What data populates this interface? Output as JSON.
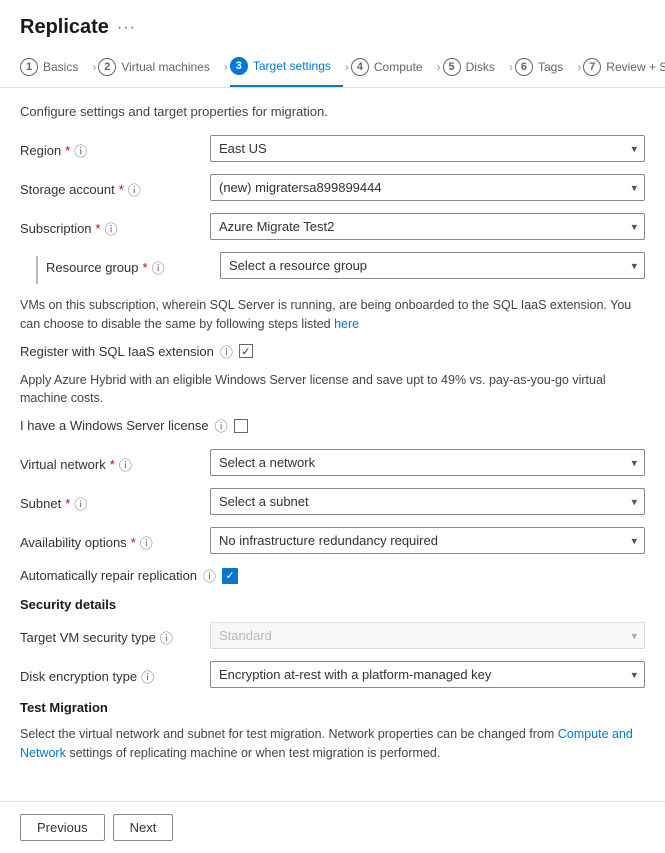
{
  "header": {
    "title": "Replicate",
    "dots": "···"
  },
  "wizard": {
    "steps": [
      {
        "num": "1",
        "label": "Basics",
        "active": false
      },
      {
        "num": "2",
        "label": "Virtual machines",
        "active": false
      },
      {
        "num": "3",
        "label": "Target settings",
        "active": true
      },
      {
        "num": "4",
        "label": "Compute",
        "active": false
      },
      {
        "num": "5",
        "label": "Disks",
        "active": false
      },
      {
        "num": "6",
        "label": "Tags",
        "active": false
      },
      {
        "num": "7",
        "label": "Review + Start replication",
        "active": false
      }
    ]
  },
  "content": {
    "section_desc": "Configure settings and target properties for migration.",
    "region": {
      "label": "Region",
      "required": true,
      "value": "East US"
    },
    "storage_account": {
      "label": "Storage account",
      "required": true,
      "value": "(new) migratersa899899444"
    },
    "subscription": {
      "label": "Subscription",
      "required": true,
      "value": "Azure Migrate Test2"
    },
    "resource_group": {
      "label": "Resource group",
      "required": true,
      "placeholder": "Select a resource group"
    },
    "sql_info_text": "VMs on this subscription, wherein SQL Server is running, are being onboarded to the SQL IaaS extension. You can choose to disable the same by following steps listed",
    "sql_info_link": "here",
    "register_sql_label": "Register with SQL IaaS extension",
    "azure_hybrid_text": "Apply Azure Hybrid with an eligible Windows Server license and save upt to 49% vs. pay-as-you-go virtual machine costs.",
    "windows_license_label": "I have a Windows Server license",
    "virtual_network": {
      "label": "Virtual network",
      "required": true,
      "placeholder": "Select a network"
    },
    "subnet": {
      "label": "Subnet",
      "required": true,
      "placeholder": "Select a subnet"
    },
    "availability_options": {
      "label": "Availability options",
      "required": true,
      "value": "No infrastructure redundancy required"
    },
    "auto_repair_label": "Automatically repair replication",
    "security_details": {
      "title": "Security details",
      "target_vm_security": {
        "label": "Target VM security type",
        "placeholder": "Standard"
      },
      "disk_encryption": {
        "label": "Disk encryption type",
        "value": "Encryption at-rest with a platform-managed key"
      }
    },
    "test_migration": {
      "title": "Test Migration",
      "desc_part1": "Select the virtual network and subnet for test migration. Network properties can be changed from",
      "desc_link1": "Compute and Network",
      "desc_part2": "settings of replicating machine or when test migration is performed."
    }
  },
  "footer": {
    "previous_label": "Previous",
    "next_label": "Next"
  },
  "icons": {
    "info": "ⓘ",
    "chevron_down": "▾",
    "check": "✓"
  }
}
